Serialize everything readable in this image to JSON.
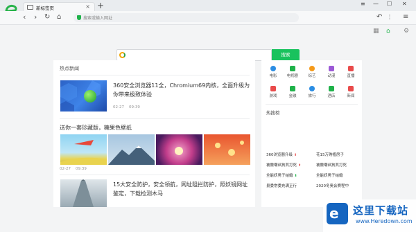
{
  "tab": {
    "title": "新标签页",
    "close": "×"
  },
  "new_tab": "+",
  "window": {
    "menu": "≡",
    "minimize": "—",
    "maximize": "☐",
    "close": "✕"
  },
  "nav": {
    "back": "‹",
    "forward": "›",
    "reload": "↻",
    "home": "⌂"
  },
  "address": {
    "placeholder": "搜索或输入网址"
  },
  "toolbar_right": {
    "undo": "↶",
    "more": "⋮",
    "menu": "≡"
  },
  "sub_tools": {
    "grid": "▦",
    "home": "⌂",
    "settings": "⚙"
  },
  "search": {
    "button": "搜索"
  },
  "news": {
    "title": "热点新闻",
    "items": [
      {
        "title": "360安全浏览器11全，Chromium69内核，全面升级为你带来极致体验",
        "date": "02-27",
        "time": "09:39"
      },
      {
        "title": "送你一套珍藏版，糖果色壁纸",
        "date": "02-27",
        "time": "09:39"
      },
      {
        "title": "15大安全防护，安全领航，网址阻拦防护，照妖镜网址鉴定，下载检测木马"
      }
    ]
  },
  "categories": [
    {
      "label": "电影",
      "color": "#2b8de3"
    },
    {
      "label": "电视剧",
      "color": "#1fb24a"
    },
    {
      "label": "综艺",
      "color": "#f59a1a"
    },
    {
      "label": "动漫",
      "color": "#9b59d6"
    },
    {
      "label": "直播",
      "color": "#e94b4b"
    },
    {
      "label": "游戏",
      "color": "#e94b4b"
    },
    {
      "label": "金融",
      "color": "#1fb24a"
    },
    {
      "label": "旅行",
      "color": "#2b8de3"
    },
    {
      "label": "酒店",
      "color": "#1fb24a"
    },
    {
      "label": "新闻",
      "color": "#e94b4b"
    }
  ],
  "hot_search": {
    "title": "热搜榜",
    "left": [
      {
        "text": "360浏览器升级",
        "trend": "up"
      },
      {
        "text": "被撒嘲讽狗其打死",
        "trend": "up"
      },
      {
        "text": "全能妖男子结婚",
        "trend": "down"
      },
      {
        "text": "县委常委充满正行",
        "trend": ""
      }
    ],
    "right": [
      {
        "text": "花15万购植房子"
      },
      {
        "text": "被撒嘲讽狗其打死"
      },
      {
        "text": "全能妖男子结婚"
      },
      {
        "text": "2020冬奥会赛程中"
      }
    ]
  },
  "watermark": {
    "title": "这里下载站",
    "url": "www.Heredown.com",
    "logo_letter": "e"
  }
}
